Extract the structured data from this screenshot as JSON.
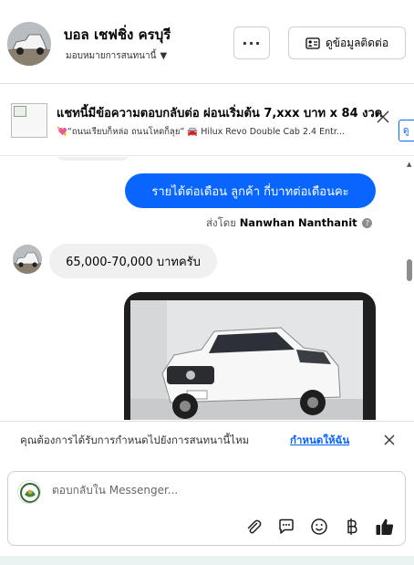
{
  "header": {
    "page_name": "บอล เชฟชิ่ง ครบุรี",
    "subtitle": "มอบหมายการสนทนานี้",
    "more_label": "···",
    "contact_label": "ดูข้อมูลติดต่อ"
  },
  "ad": {
    "title": "แชทนี้มีข้อความตอบกลับต่อ ผ่อนเริ่มต้น 7,xxx บาท x 84 งวด",
    "text": "💘“ถนนเรียบก็หล่อ ถนนโหดก็ลุย” 🚘 Hilux Revo Double Cab 2.4 Entr...",
    "more_label": "ดู"
  },
  "messages": {
    "outgoing_text": "รายได้ต่อเดือน ลูกค้า กี่บาทต่อเดือนคะ",
    "sent_by_prefix": "ส่งโดย",
    "sent_by_name": "Nanwhan Nanthanit",
    "incoming_text": "65,000-70,000 บาทครับ"
  },
  "banner": {
    "text": "คุณต้องการได้รับการกำหนดไปยังการสนทนานี้ไหม",
    "link": "กำหนดให้ฉัน"
  },
  "composer": {
    "placeholder": "ตอบกลับใน Messenger..."
  },
  "icons": {
    "contact": "contact-card-icon",
    "close": "close-icon",
    "attach": "paperclip-icon",
    "quick_reply": "chat-bubble-icon",
    "emoji": "smiley-icon",
    "payment": "baht-icon",
    "like": "thumbs-up-icon"
  },
  "colors": {
    "accent": "#0866ff",
    "bubble_in": "#f0f0f0",
    "text_secondary": "#65676b"
  }
}
